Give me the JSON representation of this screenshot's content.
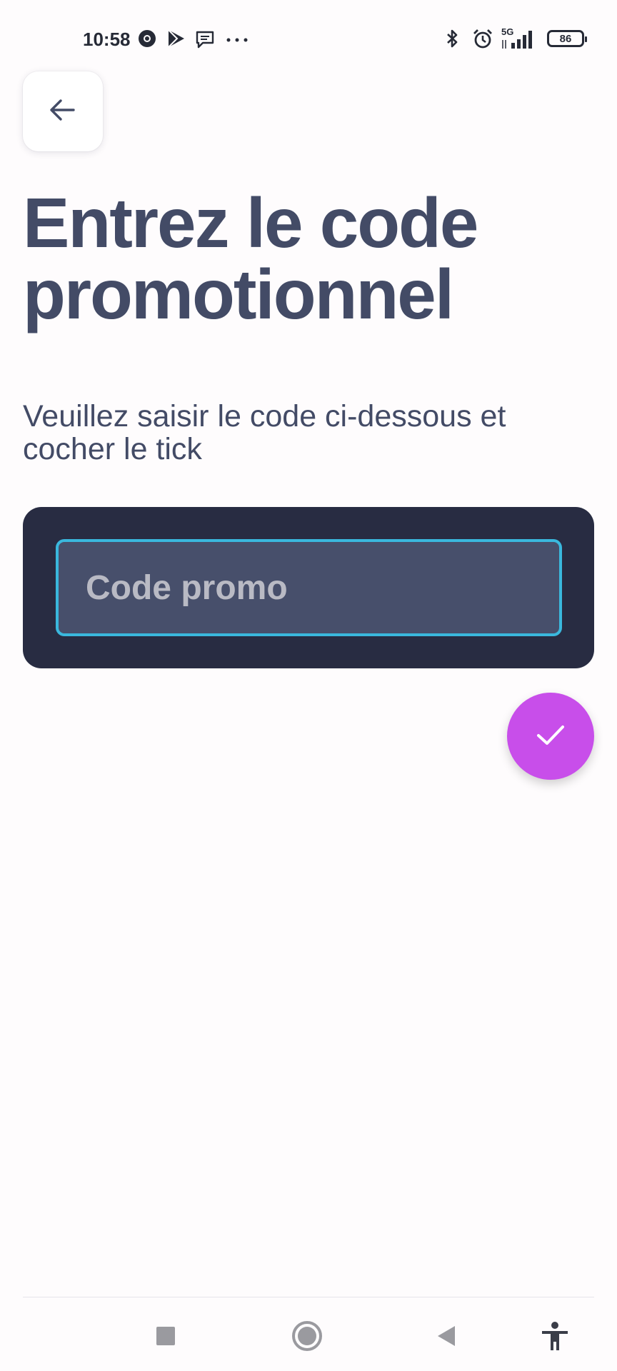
{
  "status_bar": {
    "time": "10:58",
    "left_icons": [
      "chrome-icon",
      "play-store-icon",
      "chat-bubble-icon",
      "more-dots-icon"
    ],
    "network_label": "5G",
    "battery": "86"
  },
  "back_button": {
    "icon": "arrow-left-icon"
  },
  "title": "Entrez le code promotionnel",
  "subtitle": "Veuillez saisir le code ci-dessous et cocher le tick",
  "promo_input": {
    "placeholder": "Code promo",
    "value": ""
  },
  "confirm_button": {
    "icon": "check-icon"
  },
  "colors": {
    "accent": "#c84eea",
    "input_border": "#3ab8dd",
    "card_bg": "#282c42",
    "title_text": "#434b66"
  },
  "nav_bar": {
    "buttons": [
      "recents-square-icon",
      "home-circle-icon",
      "back-triangle-icon",
      "accessibility-icon"
    ]
  }
}
